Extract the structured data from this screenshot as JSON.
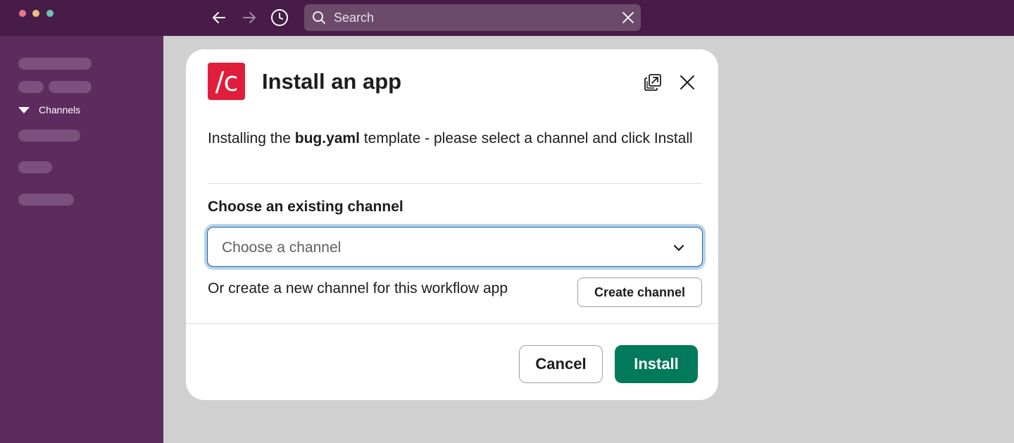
{
  "window": {
    "traffic_lights": [
      "#e27a8a",
      "#e8c27a",
      "#6fc2b3"
    ]
  },
  "toolbar": {
    "back_icon": "arrow-left-icon",
    "forward_icon": "arrow-right-icon",
    "history_icon": "clock-icon",
    "search": {
      "placeholder": "Search",
      "value": ""
    }
  },
  "sidebar": {
    "channels_label": "Channels"
  },
  "modal": {
    "title": "Install an app",
    "app_logo_text": "/c",
    "app_logo_color": "#e01e3c",
    "description_prefix": "Installing the ",
    "description_bold": "bug.yaml",
    "description_suffix": " template - please select a channel and click Install",
    "section_label": "Choose an existing channel",
    "select_placeholder": "Choose a channel",
    "create_hint": "Or create a new channel for this workflow app",
    "create_button": "Create channel",
    "cancel_button": "Cancel",
    "install_button": "Install",
    "install_color": "#007a5a"
  }
}
